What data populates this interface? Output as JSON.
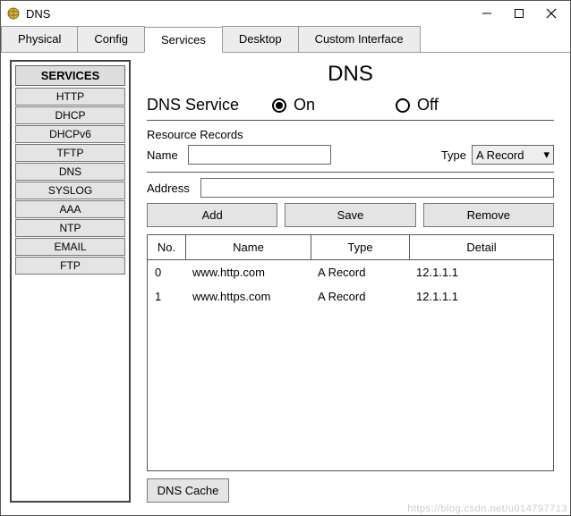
{
  "window": {
    "title": "DNS"
  },
  "tabs": [
    "Physical",
    "Config",
    "Services",
    "Desktop",
    "Custom Interface"
  ],
  "active_tab": "Services",
  "sidebar": {
    "header": "SERVICES",
    "items": [
      "HTTP",
      "DHCP",
      "DHCPv6",
      "TFTP",
      "DNS",
      "SYSLOG",
      "AAA",
      "NTP",
      "EMAIL",
      "FTP"
    ]
  },
  "main": {
    "title": "DNS",
    "service_label": "DNS Service",
    "radio_on": "On",
    "radio_off": "Off",
    "service_on": true,
    "resource_records_label": "Resource Records",
    "name_label": "Name",
    "name_value": "",
    "type_label": "Type",
    "type_value": "A Record",
    "address_label": "Address",
    "address_value": "",
    "buttons": {
      "add": "Add",
      "save": "Save",
      "remove": "Remove"
    },
    "table": {
      "headers": {
        "no": "No.",
        "name": "Name",
        "type": "Type",
        "detail": "Detail"
      },
      "rows": [
        {
          "no": "0",
          "name": "www.http.com",
          "type": "A Record",
          "detail": "12.1.1.1"
        },
        {
          "no": "1",
          "name": "www.https.com",
          "type": "A Record",
          "detail": "12.1.1.1"
        }
      ]
    },
    "dns_cache_btn": "DNS Cache"
  },
  "watermark": "https://blog.csdn.net/u014797713"
}
